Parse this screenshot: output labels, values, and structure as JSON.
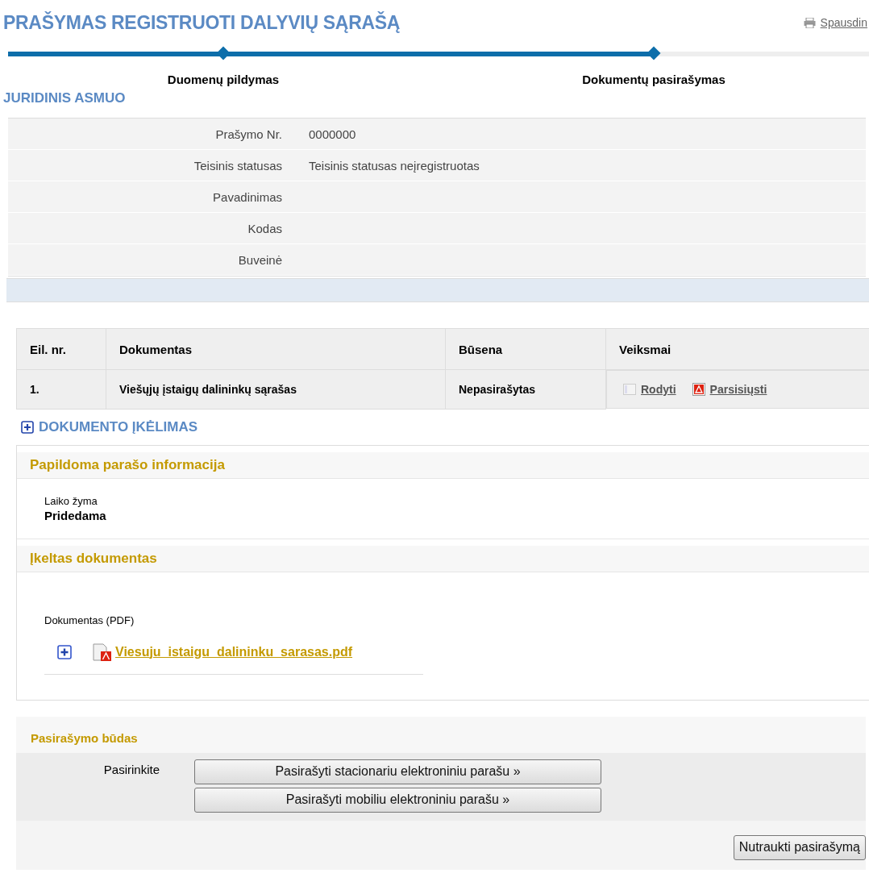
{
  "title": "PRAŠYMAS REGISTRUOTI DALYVIŲ SĄRAŠĄ",
  "print_link": "Spausdin",
  "steps": [
    {
      "label": "Duomenų pildymas",
      "reached": true
    },
    {
      "label": "Dokumentų pasirašymas",
      "reached": true
    }
  ],
  "entity": {
    "heading": "JURIDINIS ASMUO",
    "rows": [
      {
        "label": "Prašymo Nr.",
        "value": "0000000"
      },
      {
        "label": "Teisinis statusas",
        "value": "Teisinis statusas neįregistruotas"
      },
      {
        "label": "Pavadinimas"
      },
      {
        "label": "Kodas"
      },
      {
        "label": "Buveinė"
      }
    ]
  },
  "documents": {
    "columns": [
      "Eil. nr.",
      "Dokumentas",
      "Būsena",
      "Veiksmai"
    ],
    "rows": [
      {
        "number": "1.",
        "document": "Viešųjų įstaigų dalininkų sąrašas",
        "status": "Nepasirašytas",
        "actions": [
          {
            "kind": "view",
            "label": "Rodyti"
          },
          {
            "kind": "pdf",
            "label": "Parsisiųsti"
          }
        ]
      }
    ]
  },
  "upload_toggle": {
    "label": "DOKUMENTO ĮKĖLIMAS",
    "expanded": false
  },
  "signature_info": {
    "heading": "Papildoma parašo informacija",
    "field_label": "Laiko žyma",
    "field_value": "Pridedama"
  },
  "uploaded": {
    "heading": "Įkeltas dokumentas",
    "field_label": "Dokumentas (PDF)",
    "file": "Viesuju_istaigu_dalininku_sarasas.pdf"
  },
  "signing": {
    "heading": "Pasirašymo būdas",
    "label": "Pasirinkite",
    "buttons": [
      "Pasirašyti stacionariu elektroniniu parašu »",
      "Pasirašyti mobiliu elektroniniu parašu »"
    ]
  },
  "cancel_button": "Nutraukti pasirašymą"
}
